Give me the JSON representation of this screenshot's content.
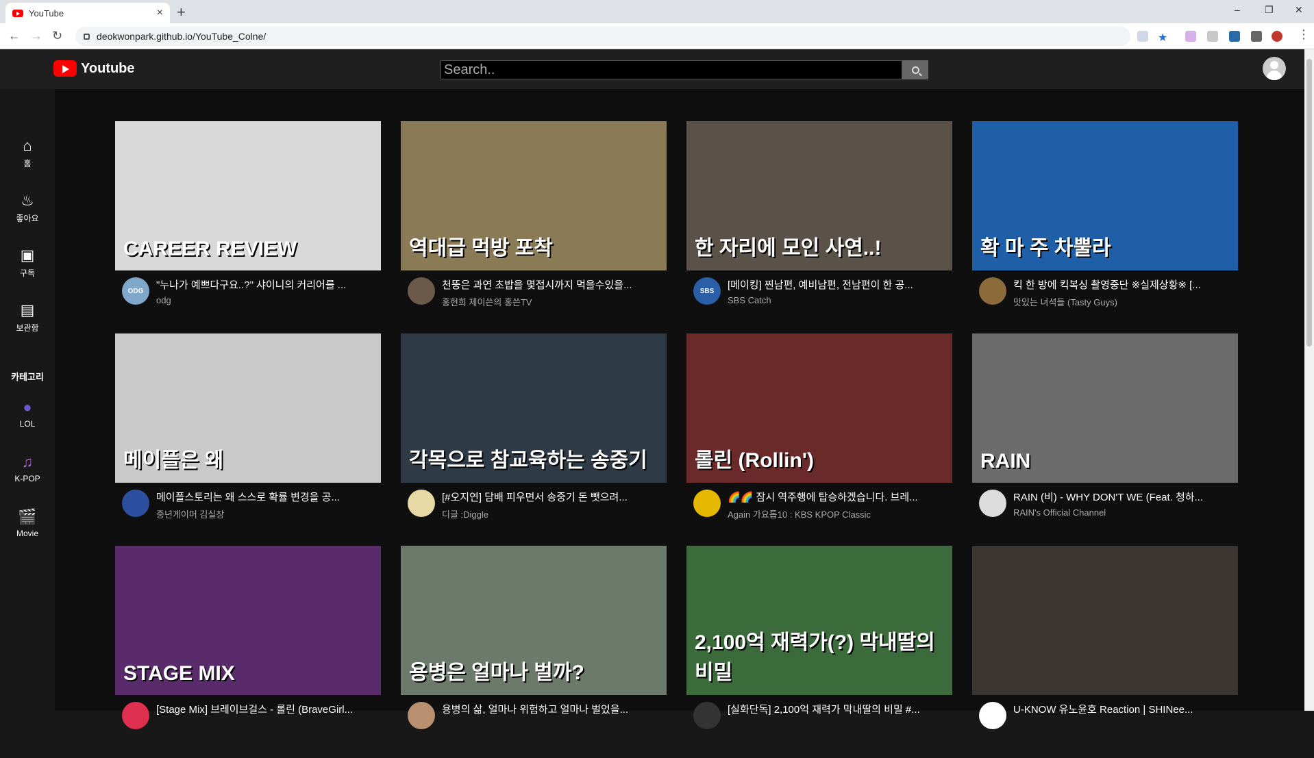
{
  "browser": {
    "tab_title": "YouTube",
    "tab_close": "×",
    "new_tab": "+",
    "url": "deokwonpark.github.io/YouTube_Colne/",
    "win_min": "–",
    "win_max": "❐",
    "win_close": "✕"
  },
  "header": {
    "logo_text": "Youtube",
    "search_placeholder": "Search.."
  },
  "sidebar": {
    "items": [
      {
        "label": "홈",
        "icon": "home-icon"
      },
      {
        "label": "좋아요",
        "icon": "fire-icon"
      },
      {
        "label": "구독",
        "icon": "subscriptions-icon"
      },
      {
        "label": "보관함",
        "icon": "library-icon"
      }
    ],
    "category_title": "카테고리",
    "categories": [
      {
        "label": "LOL",
        "icon": "lol-icon"
      },
      {
        "label": "K-POP",
        "icon": "music-icon"
      },
      {
        "label": "Movie",
        "icon": "clapper-icon"
      }
    ]
  },
  "videos": [
    {
      "title": "\"누나가 예쁘다구요..?\" 샤이니의 커리어를 ...",
      "channel": "odg",
      "thumb_text": "CAREER REVIEW",
      "thumb_color": "#d9d9d9",
      "avatar_text": "ODG",
      "avatar_color": "#7fa7c9"
    },
    {
      "title": "천뚱은 과연 초밥을 몇접시까지 먹을수있을...",
      "channel": "홍현희 제이쓴의 홍쓴TV",
      "thumb_text": "역대급 먹방 포착",
      "thumb_color": "#8a7a55",
      "avatar_text": "",
      "avatar_color": "#6b5a4a"
    },
    {
      "title": "[메이킹] 찐남편, 예비남편, 전남편이 한 공...",
      "channel": "SBS Catch",
      "thumb_text": "한 자리에 모인 사연..!",
      "thumb_color": "#5a5248",
      "avatar_text": "SBS",
      "avatar_color": "#2a5fa8"
    },
    {
      "title": "킥 한 방에 킥복싱 촬영중단 ※실제상황※ [...",
      "channel": "맛있는 녀석들 (Tasty Guys)",
      "thumb_text": "확 마 주 차뿔라",
      "thumb_color": "#1e5fa8",
      "avatar_text": "",
      "avatar_color": "#8b6b3a"
    },
    {
      "title": "메이플스토리는 왜 스스로 확률 변경을 공...",
      "channel": "중년게이머 김실장",
      "thumb_text": "메이플은 왜",
      "thumb_color": "#c9c9c9",
      "avatar_text": "",
      "avatar_color": "#2d4fa0"
    },
    {
      "title": "[#오지연] 담배 피우면서 송중기 돈 뺏으려...",
      "channel": "디글 :Diggle",
      "thumb_text": "각목으로 참교육하는 송중기",
      "thumb_color": "#2e3a46",
      "avatar_text": "",
      "avatar_color": "#e7d9a5"
    },
    {
      "title": "🌈🌈 잠시 역주행에 탑승하겠습니다. 브레...",
      "channel": "Again 가요톱10 : KBS KPOP Classic",
      "thumb_text": "롤린 (Rollin')",
      "thumb_color": "#6a2a2a",
      "avatar_text": "",
      "avatar_color": "#e6b800"
    },
    {
      "title": "RAIN (비) - WHY DON'T WE (Feat. 청하...",
      "channel": "RAIN's Official Channel",
      "thumb_text": "RAIN",
      "thumb_color": "#6b6b6b",
      "avatar_text": "",
      "avatar_color": "#dddddd"
    },
    {
      "title": "[Stage Mix] 브레이브걸스 - 롤린 (BraveGirl...",
      "channel": "",
      "thumb_text": "STAGE MIX",
      "thumb_color": "#5a2b6a",
      "avatar_text": "",
      "avatar_color": "#e03050"
    },
    {
      "title": "용병의 삶, 얼마나 위험하고 얼마나 벌었을...",
      "channel": "",
      "thumb_text": "용병은 얼마나 벌까?",
      "thumb_color": "#6b7a6a",
      "avatar_text": "",
      "avatar_color": "#b89070"
    },
    {
      "title": "[실화단독] 2,100억 재력가 막내딸의 비밀 #...",
      "channel": "",
      "thumb_text": "2,100억 재력가(?) 막내딸의 비밀",
      "thumb_color": "#3b6b3a",
      "avatar_text": "",
      "avatar_color": "#333333"
    },
    {
      "title": "U-KNOW 유노윤호 Reaction | SHINee...",
      "channel": "",
      "thumb_text": "",
      "thumb_color": "#3a3530",
      "avatar_text": "",
      "avatar_color": "#ffffff"
    }
  ]
}
